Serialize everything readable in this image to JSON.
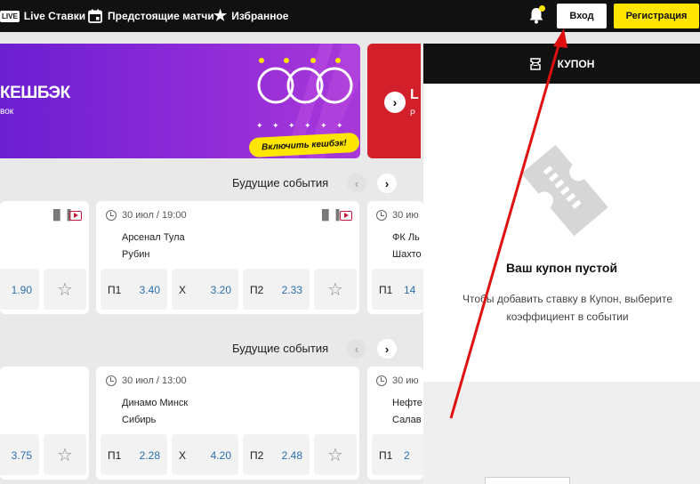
{
  "topbar": {
    "live_badge": "LIVE",
    "live_label": "Live Ставки",
    "upcoming_label": "Предстоящие матчи",
    "favorites_label": "Избранное",
    "login_label": "Вход",
    "register_label": "Регистрация"
  },
  "promo": {
    "title": "КЕШБЭК",
    "subtitle": "вок",
    "cta": "Включить кешбэк!",
    "red_title": "L",
    "red_sub": "P"
  },
  "sections": [
    {
      "title": "Будущие события",
      "cards": [
        {
          "partial": true,
          "odd_value": "1.90"
        },
        {
          "time": "30 июл / 19:00",
          "team1": "Арсенал Тула",
          "team2": "Рубин",
          "odds": [
            {
              "label": "П1",
              "value": "3.40"
            },
            {
              "label": "Х",
              "value": "3.20"
            },
            {
              "label": "П2",
              "value": "2.33"
            }
          ]
        },
        {
          "time": "30 ию",
          "team1": "ФК Ль",
          "team2": "Шахто",
          "odd_label": "П1",
          "odd_value": "14"
        }
      ]
    },
    {
      "title": "Будущие события",
      "cards": [
        {
          "partial": true,
          "odd_value": "3.75"
        },
        {
          "time": "30 июл / 13:00",
          "team1": "Динамо Минск",
          "team2": "Сибирь",
          "odds": [
            {
              "label": "П1",
              "value": "2.28"
            },
            {
              "label": "Х",
              "value": "4.20"
            },
            {
              "label": "П2",
              "value": "2.48"
            }
          ]
        },
        {
          "time": "30 ию",
          "team1": "Нефте",
          "team2": "Салав",
          "odd_label": "П1",
          "odd_value": "2"
        }
      ]
    }
  ],
  "coupon": {
    "title": "КУПОН",
    "empty_title": "Ваш купон пустой",
    "empty_text": "Чтобы добавить ставку в Купон, выберите коэффициент в событии"
  },
  "colors": {
    "brand_yellow": "#ffe600",
    "topbar_bg": "#111111",
    "odd_value": "#2a6fb0",
    "annotation_arrow": "#e01010"
  }
}
